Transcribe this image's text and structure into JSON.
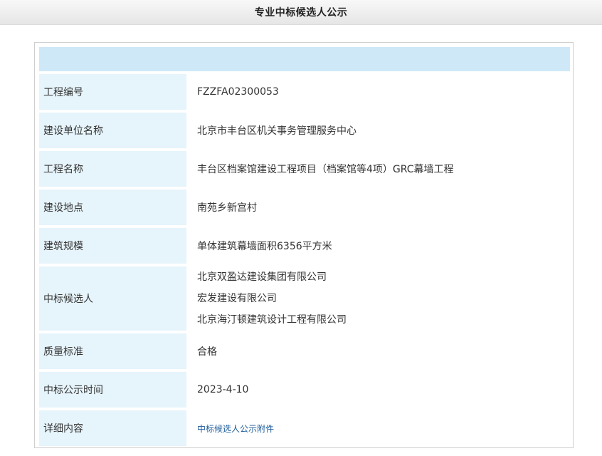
{
  "page": {
    "title": "专业中标候选人公示"
  },
  "rows": [
    {
      "label": "工程编号",
      "value": "FZZFA02300053"
    },
    {
      "label": "建设单位名称",
      "value": "北京市丰台区机关事务管理服务中心"
    },
    {
      "label": "工程名称",
      "value": "丰台区档案馆建设工程项目（档案馆等4项）GRC幕墙工程"
    },
    {
      "label": "建设地点",
      "value": "南苑乡新宫村"
    },
    {
      "label": "建筑规模",
      "value": "单体建筑幕墙面积6356平方米"
    },
    {
      "label": "中标候选人",
      "values": [
        "北京双盈达建设集团有限公司",
        "宏发建设有限公司",
        "北京海汀顿建筑设计工程有限公司"
      ]
    },
    {
      "label": "质量标准",
      "value": "合格"
    },
    {
      "label": "中标公示时间",
      "value": "2023-4-10"
    },
    {
      "label": "详细内容",
      "link_text": "中标候选人公示附件"
    }
  ]
}
